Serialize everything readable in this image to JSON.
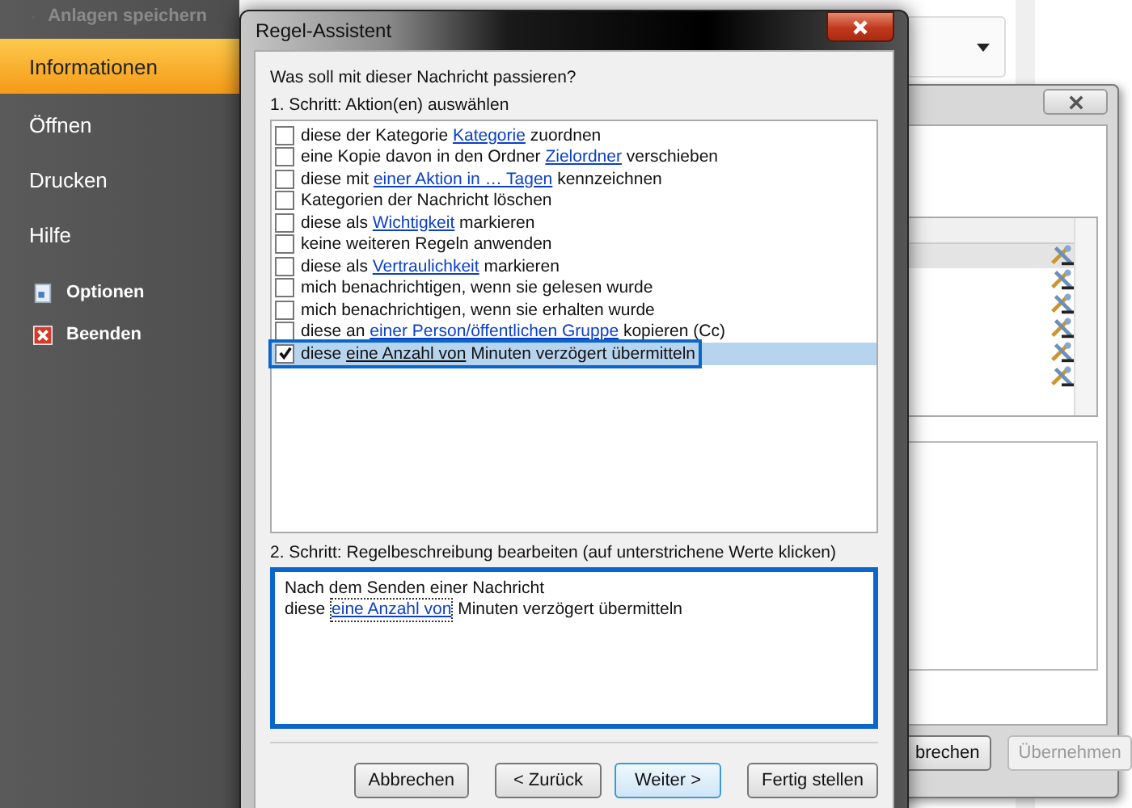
{
  "sidebar": {
    "items": [
      {
        "label": "Anlagen speichern",
        "kind": "command",
        "disabled": true,
        "selected": false
      },
      {
        "label": "Informationen",
        "kind": "page",
        "disabled": false,
        "selected": true
      },
      {
        "label": "Öffnen",
        "kind": "page",
        "disabled": false,
        "selected": false
      },
      {
        "label": "Drucken",
        "kind": "page",
        "disabled": false,
        "selected": false
      },
      {
        "label": "Hilfe",
        "kind": "page",
        "disabled": false,
        "selected": false
      },
      {
        "label": "Optionen",
        "kind": "command",
        "disabled": false,
        "selected": false
      },
      {
        "label": "Beenden",
        "kind": "command",
        "disabled": false,
        "selected": false
      }
    ]
  },
  "back_window": {
    "rows": [
      {
        "selected": true
      },
      {
        "selected": false
      },
      {
        "selected": false
      },
      {
        "selected": false
      },
      {
        "selected": false
      },
      {
        "selected": false
      }
    ],
    "buttons": [
      {
        "label": "brechen",
        "disabled": false
      },
      {
        "label": "Übernehmen",
        "disabled": true
      }
    ]
  },
  "dialog": {
    "title": "Regel-Assistent",
    "question": "Was soll mit dieser Nachricht passieren?",
    "step1_label": "1. Schritt: Aktion(en) auswählen",
    "actions": [
      {
        "checked": false,
        "selected": false,
        "highlighted": false,
        "parts": [
          {
            "text": "diese der Kategorie ",
            "link": false
          },
          {
            "text": "Kategorie",
            "link": true
          },
          {
            "text": " zuordnen",
            "link": false
          }
        ]
      },
      {
        "checked": false,
        "selected": false,
        "highlighted": false,
        "parts": [
          {
            "text": "eine Kopie davon in den Ordner ",
            "link": false
          },
          {
            "text": "Zielordner",
            "link": true
          },
          {
            "text": " verschieben",
            "link": false
          }
        ]
      },
      {
        "checked": false,
        "selected": false,
        "highlighted": false,
        "parts": [
          {
            "text": "diese mit ",
            "link": false
          },
          {
            "text": "einer Aktion in … Tagen",
            "link": true
          },
          {
            "text": " kennzeichnen",
            "link": false
          }
        ]
      },
      {
        "checked": false,
        "selected": false,
        "highlighted": false,
        "parts": [
          {
            "text": "Kategorien der Nachricht löschen",
            "link": false
          }
        ]
      },
      {
        "checked": false,
        "selected": false,
        "highlighted": false,
        "parts": [
          {
            "text": "diese als ",
            "link": false
          },
          {
            "text": "Wichtigkeit",
            "link": true
          },
          {
            "text": " markieren",
            "link": false
          }
        ]
      },
      {
        "checked": false,
        "selected": false,
        "highlighted": false,
        "parts": [
          {
            "text": "keine weiteren Regeln anwenden",
            "link": false
          }
        ]
      },
      {
        "checked": false,
        "selected": false,
        "highlighted": false,
        "parts": [
          {
            "text": "diese als ",
            "link": false
          },
          {
            "text": "Vertraulichkeit",
            "link": true
          },
          {
            "text": " markieren",
            "link": false
          }
        ]
      },
      {
        "checked": false,
        "selected": false,
        "highlighted": false,
        "parts": [
          {
            "text": "mich benachrichtigen, wenn sie gelesen wurde",
            "link": false
          }
        ]
      },
      {
        "checked": false,
        "selected": false,
        "highlighted": false,
        "parts": [
          {
            "text": "mich benachrichtigen, wenn sie erhalten wurde",
            "link": false
          }
        ]
      },
      {
        "checked": false,
        "selected": false,
        "highlighted": false,
        "parts": [
          {
            "text": "diese an ",
            "link": false
          },
          {
            "text": "einer Person/öffentlichen Gruppe",
            "link": true
          },
          {
            "text": " kopieren (Cc)",
            "link": false
          }
        ]
      },
      {
        "checked": true,
        "selected": true,
        "highlighted": true,
        "parts": [
          {
            "text": "diese ",
            "link": false
          },
          {
            "text": "eine Anzahl von",
            "link": true
          },
          {
            "text": " Minuten verzögert übermitteln",
            "link": false
          }
        ]
      }
    ],
    "step2_label": "2. Schritt: Regelbeschreibung bearbeiten (auf unterstrichene Werte klicken)",
    "description": {
      "highlighted": true,
      "lines": [
        [
          {
            "text": "Nach dem Senden einer Nachricht",
            "link": false
          }
        ],
        [
          {
            "text": "diese ",
            "link": false
          },
          {
            "text": "eine Anzahl von",
            "link": true
          },
          {
            "text": " Minuten verzögert übermitteln",
            "link": false
          }
        ]
      ]
    },
    "buttons": [
      {
        "label": "Abbrechen",
        "default": false
      },
      {
        "label": "< Zurück",
        "default": false
      },
      {
        "label": "Weiter >",
        "default": true
      },
      {
        "label": "Fertig stellen",
        "default": false
      }
    ]
  }
}
